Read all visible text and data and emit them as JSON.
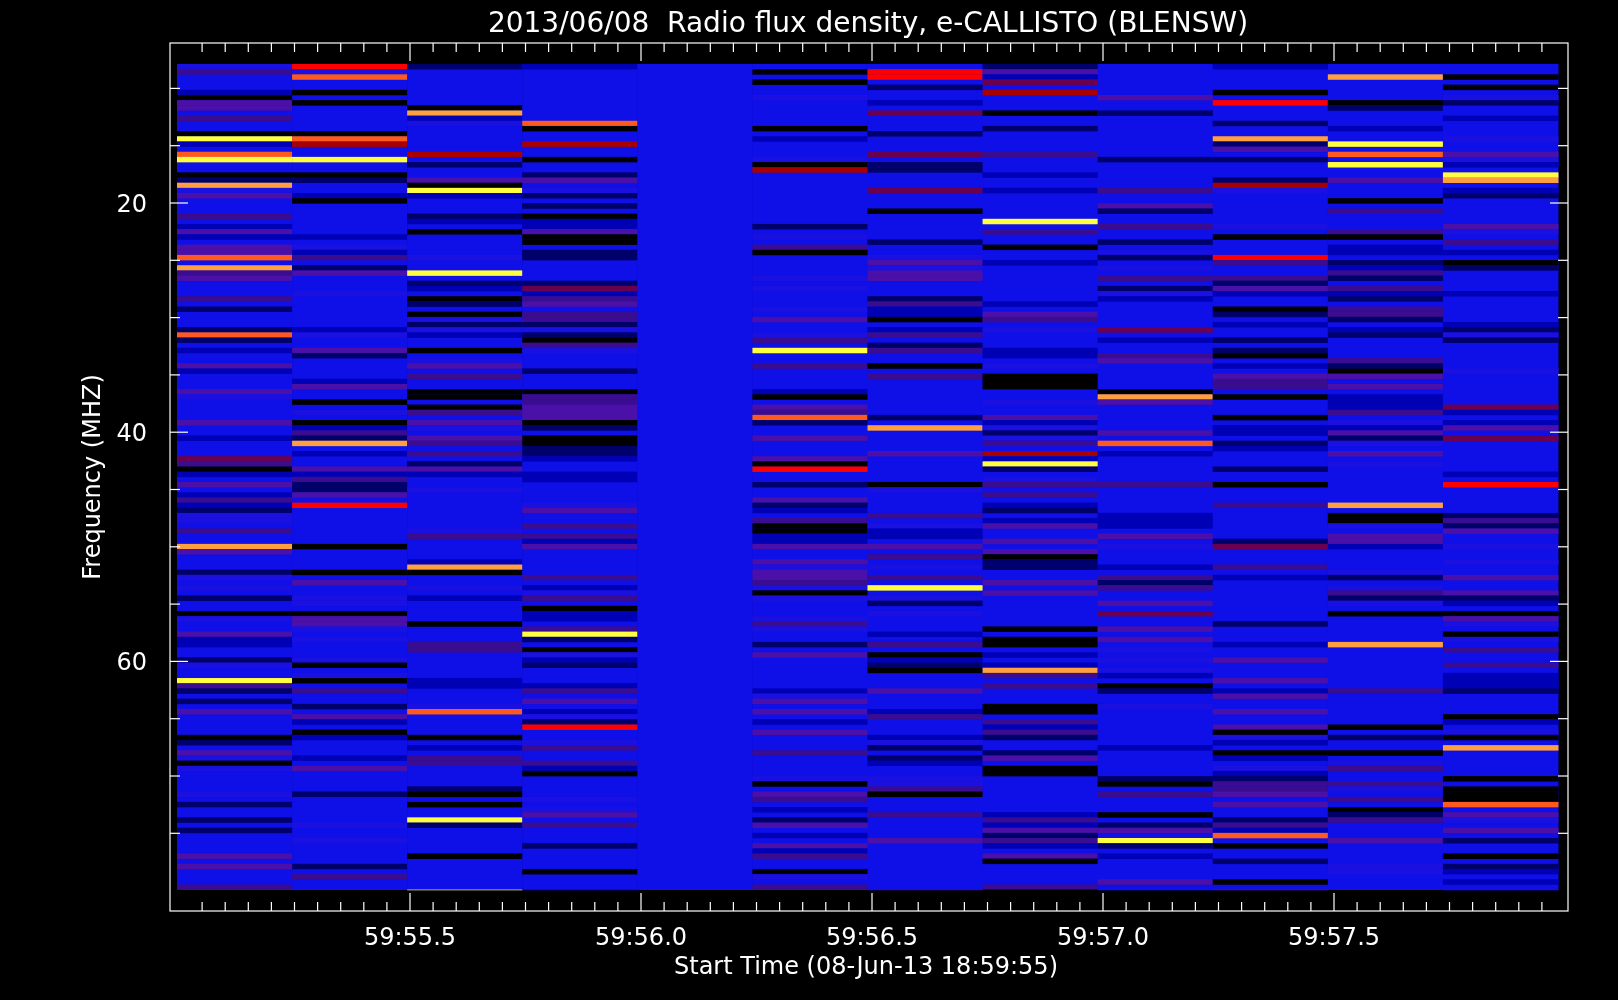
{
  "chart": {
    "title": "2013/06/08  Radio flux density, e-CALLISTO (BLENSW)",
    "ylabel": "Frequency (MHZ)",
    "xlabel": "Start Time (08-Jun-13 18:59:55)",
    "yticks": [
      "20",
      "40",
      "60"
    ],
    "xticks": [
      "59:55.5",
      "59:56.0",
      "59:56.5",
      "59:57.0",
      "59:57.5"
    ]
  }
}
